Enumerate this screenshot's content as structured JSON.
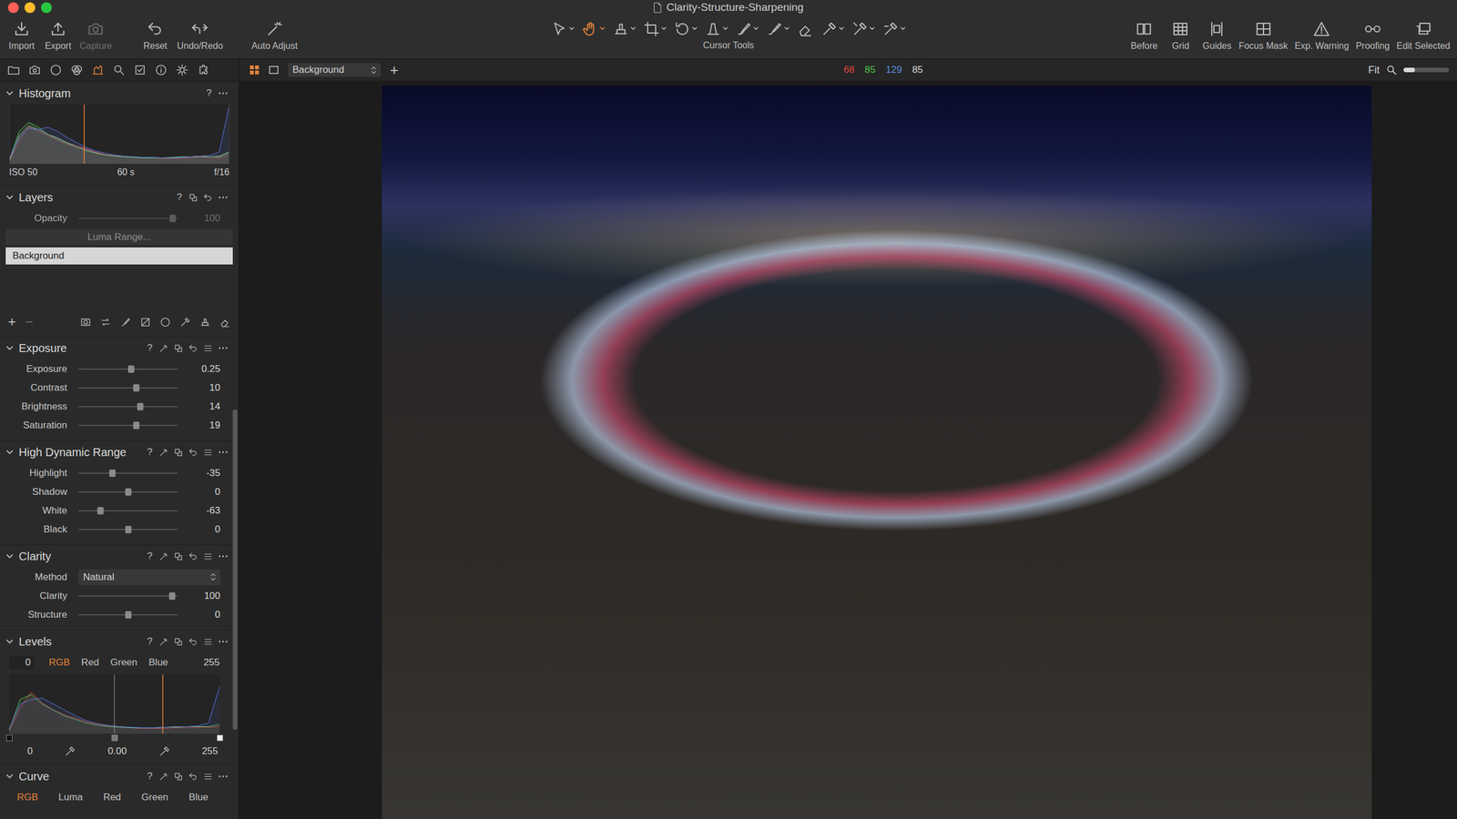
{
  "window": {
    "title": "Clarity-Structure-Sharpening",
    "controls": [
      {
        "color": "#ff5f57"
      },
      {
        "color": "#febc2e"
      },
      {
        "color": "#28c840"
      }
    ]
  },
  "toolbar": {
    "left_groups": [
      [
        {
          "label": "Import",
          "disabled": false
        },
        {
          "label": "Export",
          "disabled": false
        },
        {
          "label": "Capture",
          "disabled": true
        }
      ],
      [
        {
          "label": "Reset",
          "disabled": false
        },
        {
          "label": "Undo/Redo",
          "disabled": false
        }
      ],
      [
        {
          "label": "Auto Adjust",
          "disabled": false
        }
      ]
    ],
    "cursor_tools": {
      "label": "Cursor Tools",
      "tools": [
        {
          "selected": false,
          "menu": true
        },
        {
          "selected": true,
          "menu": true
        },
        {
          "selected": false,
          "menu": true
        },
        {
          "selected": false,
          "menu": true
        },
        {
          "selected": false,
          "menu": true
        },
        {
          "selected": false,
          "menu": true
        },
        {
          "selected": false,
          "menu": true
        },
        {
          "selected": false,
          "menu": true
        },
        {
          "selected": false,
          "menu": false
        },
        {
          "selected": false,
          "menu": true
        },
        {
          "selected": false,
          "menu": true
        },
        {
          "selected": false,
          "menu": true
        }
      ]
    },
    "right": [
      {
        "label": "Before"
      },
      {
        "label": "Grid"
      },
      {
        "label": "Guides"
      },
      {
        "label": "Focus Mask"
      },
      {
        "label": "Exp. Warning"
      },
      {
        "label": "Proofing"
      },
      {
        "label": "Edit Selected"
      }
    ]
  },
  "tool_tabs": [
    {
      "selected": false
    },
    {
      "selected": false
    },
    {
      "selected": false
    },
    {
      "selected": false
    },
    {
      "selected": true
    },
    {
      "selected": false
    },
    {
      "selected": false
    },
    {
      "selected": false
    },
    {
      "selected": false
    },
    {
      "selected": false
    }
  ],
  "viewer_bar": {
    "layer": "Background",
    "add": "+",
    "readout": [
      {
        "value": "68",
        "color": "#e0463f"
      },
      {
        "value": "85",
        "color": "#4cc84c"
      },
      {
        "value": "129",
        "color": "#5b8de0"
      },
      {
        "value": "85",
        "color": "#d8d8d8"
      }
    ],
    "zoom": {
      "label": "Fit",
      "level": 0.25
    }
  },
  "histogram": {
    "title": "Histogram",
    "help": "?",
    "expanded": true,
    "series": [
      {
        "color": "#b8b8b8",
        "values": [
          6,
          48,
          64,
          58,
          50,
          44,
          36,
          30,
          24,
          19,
          15,
          13,
          12,
          11,
          10,
          10,
          10,
          10,
          11,
          12,
          12,
          12,
          13,
          20
        ]
      },
      {
        "color": "#d8484a",
        "values": [
          5,
          40,
          62,
          55,
          48,
          40,
          33,
          30,
          26,
          20,
          16,
          14,
          12,
          11,
          10,
          10,
          9,
          9,
          9,
          10,
          12,
          10,
          10,
          14
        ]
      },
      {
        "color": "#5ec85e",
        "values": [
          8,
          55,
          70,
          62,
          50,
          42,
          35,
          28,
          22,
          18,
          15,
          13,
          12,
          11,
          10,
          10,
          10,
          11,
          12,
          12,
          13,
          12,
          12,
          18
        ]
      },
      {
        "color": "#5a78e8",
        "values": [
          10,
          45,
          60,
          58,
          62,
          55,
          45,
          36,
          28,
          22,
          18,
          15,
          13,
          12,
          11,
          11,
          10,
          10,
          11,
          12,
          13,
          14,
          20,
          95
        ]
      }
    ],
    "marker": 0.34,
    "iso": "ISO 50",
    "shutter": "60 s",
    "aperture": "f/16"
  },
  "layers": {
    "title": "Layers",
    "help": "?",
    "expanded": true,
    "opacity": {
      "label": "Opacity",
      "value": "100",
      "level": 0.95,
      "disabled": true
    },
    "luma_range": "Luma Range...",
    "items": [
      {
        "name": "Background",
        "selected": true
      }
    ],
    "add": "+",
    "remove": "−"
  },
  "sections": [
    {
      "title": "Exposure",
      "help": "?",
      "expanded": true,
      "rows": [
        {
          "kind": "slider",
          "label": "Exposure",
          "value": "0.25",
          "level": 0.53
        },
        {
          "kind": "slider",
          "label": "Contrast",
          "value": "10",
          "level": 0.58
        },
        {
          "kind": "slider",
          "label": "Brightness",
          "value": "14",
          "level": 0.62
        },
        {
          "kind": "slider",
          "label": "Saturation",
          "value": "19",
          "level": 0.58
        }
      ]
    },
    {
      "title": "High Dynamic Range",
      "help": "?",
      "expanded": true,
      "rows": [
        {
          "kind": "slider",
          "label": "Highlight",
          "value": "-35",
          "level": 0.34
        },
        {
          "kind": "slider",
          "label": "Shadow",
          "value": "0",
          "level": 0.5
        },
        {
          "kind": "slider",
          "label": "White",
          "value": "-63",
          "level": 0.22
        },
        {
          "kind": "slider",
          "label": "Black",
          "value": "0",
          "level": 0.5
        }
      ]
    },
    {
      "title": "Clarity",
      "help": "?",
      "expanded": true,
      "rows": [
        {
          "kind": "select",
          "label": "Method",
          "value": "Natural"
        },
        {
          "kind": "slider",
          "label": "Clarity",
          "value": "100",
          "level": 0.94
        },
        {
          "kind": "slider",
          "label": "Structure",
          "value": "0",
          "level": 0.5
        }
      ]
    }
  ],
  "levels": {
    "title": "Levels",
    "help": "?",
    "expanded": true,
    "input_low": "0",
    "input_high": "255",
    "channels": [
      {
        "label": "RGB",
        "selected": true
      },
      {
        "label": "Red",
        "selected": false
      },
      {
        "label": "Green",
        "selected": false
      },
      {
        "label": "Blue",
        "selected": false
      }
    ],
    "series": [
      {
        "color": "#d8484a",
        "values": [
          4,
          44,
          70,
          52,
          40,
          32,
          26,
          20,
          16,
          13,
          11,
          10,
          9,
          9,
          9,
          10,
          10,
          11,
          11,
          12
        ]
      },
      {
        "color": "#5ec85e",
        "values": [
          6,
          58,
          66,
          50,
          40,
          30,
          24,
          18,
          14,
          12,
          11,
          10,
          10,
          10,
          11,
          11,
          12,
          12,
          12,
          16
        ]
      },
      {
        "color": "#5a78e8",
        "values": [
          8,
          50,
          58,
          60,
          50,
          40,
          30,
          22,
          17,
          14,
          12,
          11,
          10,
          10,
          11,
          12,
          12,
          13,
          18,
          80
        ]
      }
    ],
    "low": 0,
    "mid": 0.5,
    "high": 1,
    "marker": 0.73,
    "output_low": "0",
    "midpoint": "0.00",
    "output_high": "255"
  },
  "curve": {
    "title": "Curve",
    "help": "?",
    "expanded": true,
    "channels": [
      {
        "label": "RGB",
        "selected": true
      },
      {
        "label": "Luma",
        "selected": false
      },
      {
        "label": "Red",
        "selected": false
      },
      {
        "label": "Green",
        "selected": false
      },
      {
        "label": "Blue",
        "selected": false
      }
    ]
  },
  "panel_scroll": {
    "position": 0.41,
    "size": 0.4
  }
}
